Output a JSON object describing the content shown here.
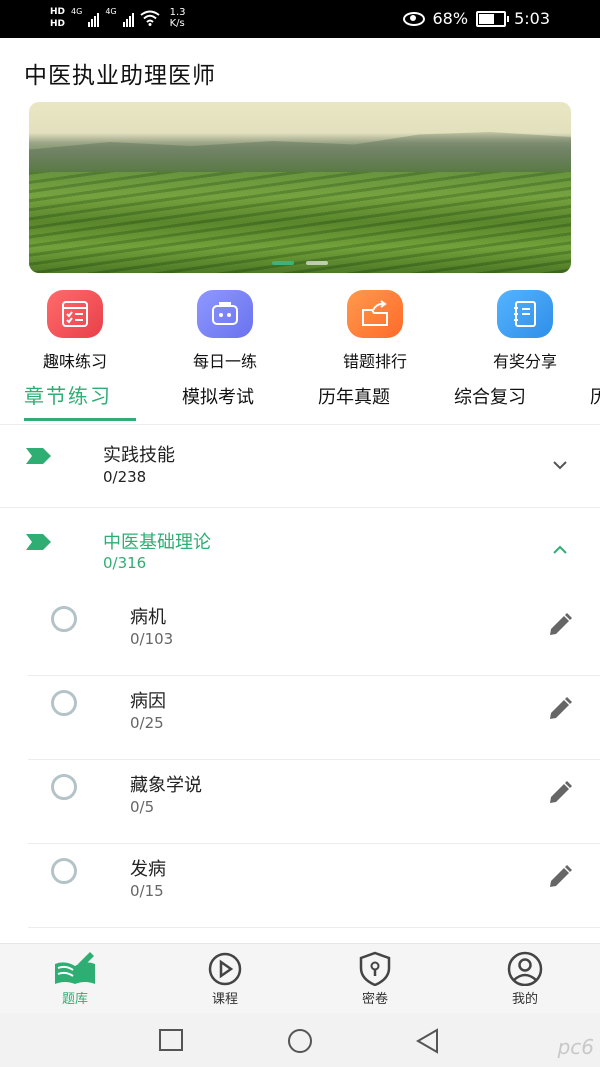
{
  "status_bar": {
    "hd1": "HD",
    "hd2": "HD",
    "network1": "4G",
    "network2": "4G",
    "speed_value": "1.3",
    "speed_unit": "K/s",
    "battery": "68%",
    "battery_level": 0.68,
    "time": "5:03"
  },
  "header": {
    "title": "中医执业助理医师"
  },
  "banner": {
    "slide_count": 2,
    "active_slide": 1
  },
  "quick_actions": [
    {
      "label": "趣味练习",
      "icon": "checklist-icon",
      "color": "#f0535a"
    },
    {
      "label": "每日一练",
      "icon": "robot-face-icon",
      "color": "#7b84f5"
    },
    {
      "label": "错题排行",
      "icon": "share-folder-icon",
      "color": "#ff7b3a"
    },
    {
      "label": "有奖分享",
      "icon": "notebook-icon",
      "color": "#3d9cf0"
    }
  ],
  "tabs": [
    {
      "label": "章节练习",
      "active": true
    },
    {
      "label": "模拟考试"
    },
    {
      "label": "历年真题"
    },
    {
      "label": "综合复习"
    },
    {
      "label": "历"
    }
  ],
  "chapters": [
    {
      "title": "实践技能",
      "count": "0/238",
      "expanded": false
    },
    {
      "title": "中医基础理论",
      "count": "0/316",
      "expanded": true,
      "subsections": [
        {
          "title": "病机",
          "count": "0/103"
        },
        {
          "title": "病因",
          "count": "0/25"
        },
        {
          "title": "藏象学说",
          "count": "0/5"
        },
        {
          "title": "发病",
          "count": "0/15"
        }
      ]
    }
  ],
  "bottom_nav": [
    {
      "label": "题库",
      "icon": "book-pen-icon",
      "active": true
    },
    {
      "label": "课程",
      "icon": "play-circle-icon"
    },
    {
      "label": "密卷",
      "icon": "shield-lock-icon"
    },
    {
      "label": "我的",
      "icon": "user-icon"
    }
  ],
  "watermark": "pc6",
  "colors": {
    "accent": "#2fae74",
    "statusbar": "#000000"
  }
}
